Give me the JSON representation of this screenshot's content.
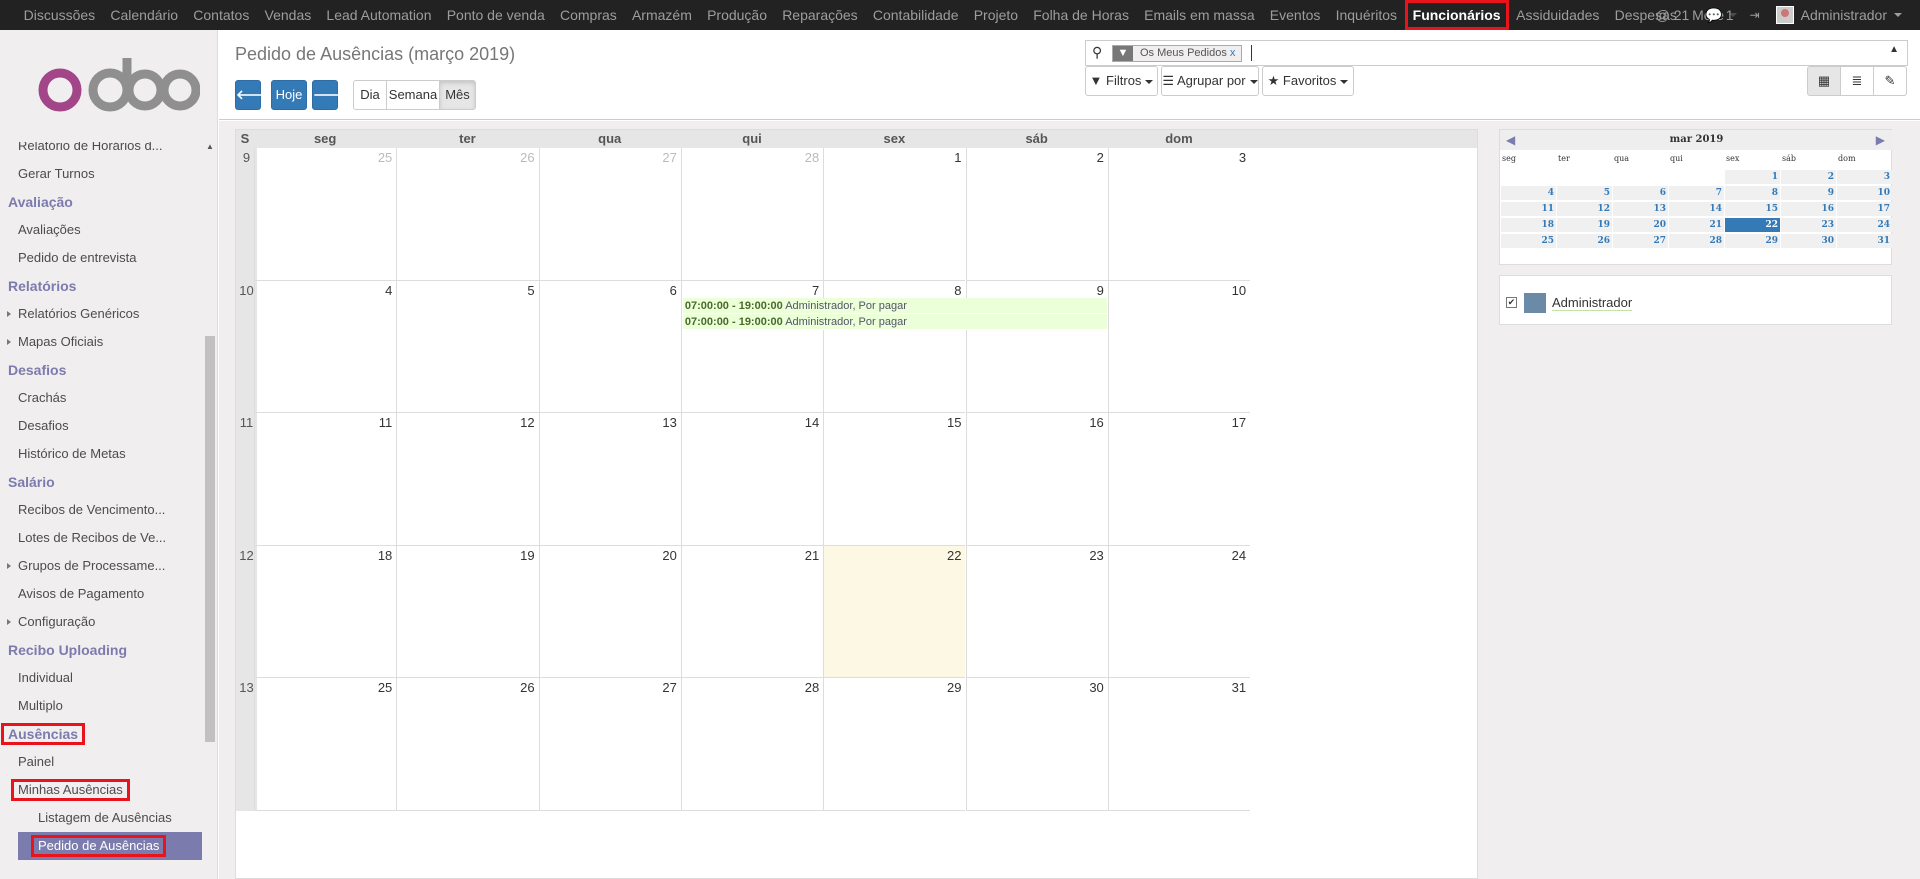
{
  "topbar": {
    "menu": [
      "Discussões",
      "Calendário",
      "Contatos",
      "Vendas",
      "Lead Automation",
      "Ponto de venda",
      "Compras",
      "Armazém",
      "Produção",
      "Reparações",
      "Contabilidade",
      "Projeto",
      "Folha de Horas",
      "Emails em massa",
      "Eventos",
      "Inquéritos",
      "Funcionários",
      "Assiduidades",
      "Despesas",
      "More"
    ],
    "active": "Funcionários",
    "mentions": "@ 21",
    "chat_count": "1",
    "user": "Administrador"
  },
  "sidebar": {
    "logo": "odoo",
    "items": [
      {
        "t": "lnk",
        "label": "Relatório de Horários d..."
      },
      {
        "t": "lnk",
        "label": "Gerar Turnos"
      },
      {
        "t": "sec",
        "label": "Avaliação"
      },
      {
        "t": "lnk",
        "label": "Avaliações"
      },
      {
        "t": "lnk",
        "label": "Pedido de entrevista"
      },
      {
        "t": "sec",
        "label": "Relatórios"
      },
      {
        "t": "lnk",
        "label": "Relatórios Genéricos",
        "arrow": true
      },
      {
        "t": "lnk",
        "label": "Mapas Oficiais",
        "arrow": true
      },
      {
        "t": "sec",
        "label": "Desafios"
      },
      {
        "t": "lnk",
        "label": "Crachás"
      },
      {
        "t": "lnk",
        "label": "Desafios"
      },
      {
        "t": "lnk",
        "label": "Histórico de Metas"
      },
      {
        "t": "sec",
        "label": "Salário"
      },
      {
        "t": "lnk",
        "label": "Recibos de Vencimento..."
      },
      {
        "t": "lnk",
        "label": "Lotes de Recibos de Ve..."
      },
      {
        "t": "lnk",
        "label": "Grupos de Processame...",
        "arrow": true
      },
      {
        "t": "lnk",
        "label": "Avisos de Pagamento"
      },
      {
        "t": "lnk",
        "label": "Configuração",
        "arrow": true
      },
      {
        "t": "sec",
        "label": "Recibo Uploading"
      },
      {
        "t": "lnk",
        "label": "Individual"
      },
      {
        "t": "lnk",
        "label": "Multiplo"
      },
      {
        "t": "sec",
        "label": "Ausências",
        "highlight": true
      },
      {
        "t": "lnk",
        "label": "Painel"
      },
      {
        "t": "lnk",
        "label": "Minhas Ausências",
        "highlight": true
      },
      {
        "t": "lnk",
        "label": "Listagem de Ausências",
        "sub": true
      },
      {
        "t": "lnk",
        "label": "Pedido de Ausências",
        "sub": true,
        "selected": true,
        "highlight": true
      }
    ]
  },
  "control": {
    "title": "Pedido de Ausências (março 2019)",
    "today": "Hoje",
    "views": [
      "Dia",
      "Semana",
      "Mês"
    ],
    "active_view": "Mês",
    "facet": "Os Meus Pedidos",
    "facet_remove": "x",
    "filters": "Filtros",
    "groupby": "Agrupar por",
    "favorites": "Favoritos"
  },
  "calendar": {
    "week_header": "S",
    "days": [
      "seg",
      "ter",
      "qua",
      "qui",
      "sex",
      "sáb",
      "dom"
    ],
    "weeks": [
      {
        "n": "9",
        "d": [
          "25",
          "26",
          "27",
          "28",
          "1",
          "2",
          "3"
        ],
        "other": [
          0,
          1,
          2,
          3
        ]
      },
      {
        "n": "10",
        "d": [
          "4",
          "5",
          "6",
          "7",
          "8",
          "9",
          "10"
        ],
        "other": []
      },
      {
        "n": "11",
        "d": [
          "11",
          "12",
          "13",
          "14",
          "15",
          "16",
          "17"
        ],
        "other": []
      },
      {
        "n": "12",
        "d": [
          "18",
          "19",
          "20",
          "21",
          "22",
          "23",
          "24"
        ],
        "other": []
      },
      {
        "n": "13",
        "d": [
          "25",
          "26",
          "27",
          "28",
          "29",
          "30",
          "31"
        ],
        "other": []
      }
    ],
    "today_cell": [
      3,
      4
    ],
    "events": [
      {
        "time": "07:00:00 - 19:00:00",
        "text": "Administrador, Por pagar",
        "week": 1,
        "start": 3,
        "end": 5
      },
      {
        "time": "07:00:00 - 19:00:00",
        "text": "Administrador, Por pagar",
        "week": 1,
        "start": 3,
        "end": 5
      }
    ]
  },
  "mini": {
    "title": "mar 2019",
    "prev": "◀",
    "next": "▶",
    "days": [
      "seg",
      "ter",
      "qua",
      "qui",
      "sex",
      "sáb",
      "dom"
    ],
    "rows": [
      [
        "",
        "",
        "",
        "",
        "1",
        "2",
        "3"
      ],
      [
        "4",
        "5",
        "6",
        "7",
        "8",
        "9",
        "10"
      ],
      [
        "11",
        "12",
        "13",
        "14",
        "15",
        "16",
        "17"
      ],
      [
        "18",
        "19",
        "20",
        "21",
        "22",
        "23",
        "24"
      ],
      [
        "25",
        "26",
        "27",
        "28",
        "29",
        "30",
        "31"
      ]
    ],
    "selected": "22"
  },
  "attendee": "Administrador",
  "colors": {
    "accent": "#7c7bad",
    "primary": "#337ab7",
    "topbar": "#222222",
    "highlight": "#e8131b"
  }
}
